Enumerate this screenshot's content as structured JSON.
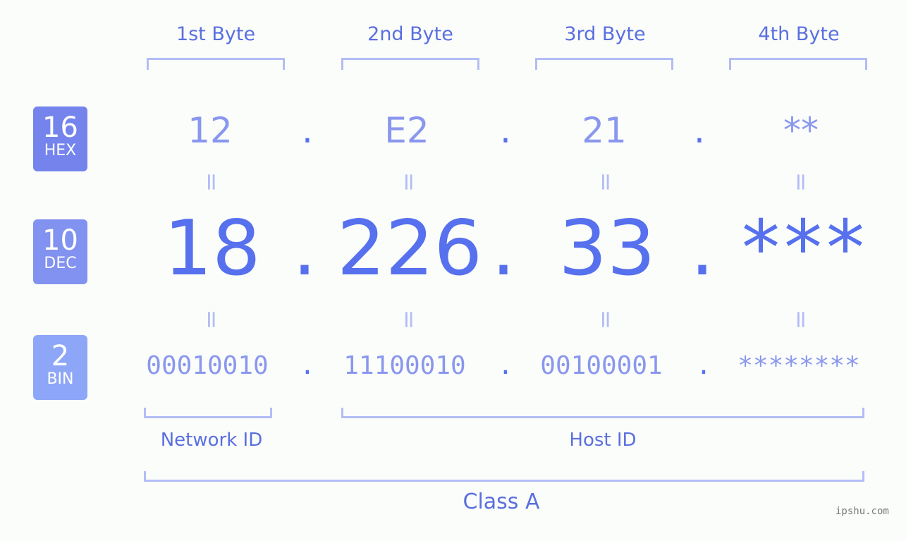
{
  "headers": [
    "1st Byte",
    "2nd Byte",
    "3rd Byte",
    "4th Byte"
  ],
  "badges": {
    "hex": {
      "num": "16",
      "label": "HEX",
      "color": "#7484ec"
    },
    "dec": {
      "num": "10",
      "label": "DEC",
      "color": "#8292f0"
    },
    "bin": {
      "num": "2",
      "label": "BIN",
      "color": "#8ea6f8"
    }
  },
  "hex": [
    "12",
    "E2",
    "21",
    "**"
  ],
  "dec": [
    "18",
    "226",
    "33",
    "***"
  ],
  "bin": [
    "00010010",
    "11100010",
    "00100001",
    "********"
  ],
  "separator": ".",
  "equals": "=",
  "labels": {
    "network": "Network ID",
    "host": "Host ID",
    "class": "Class A"
  },
  "footer": "ipshu.com"
}
